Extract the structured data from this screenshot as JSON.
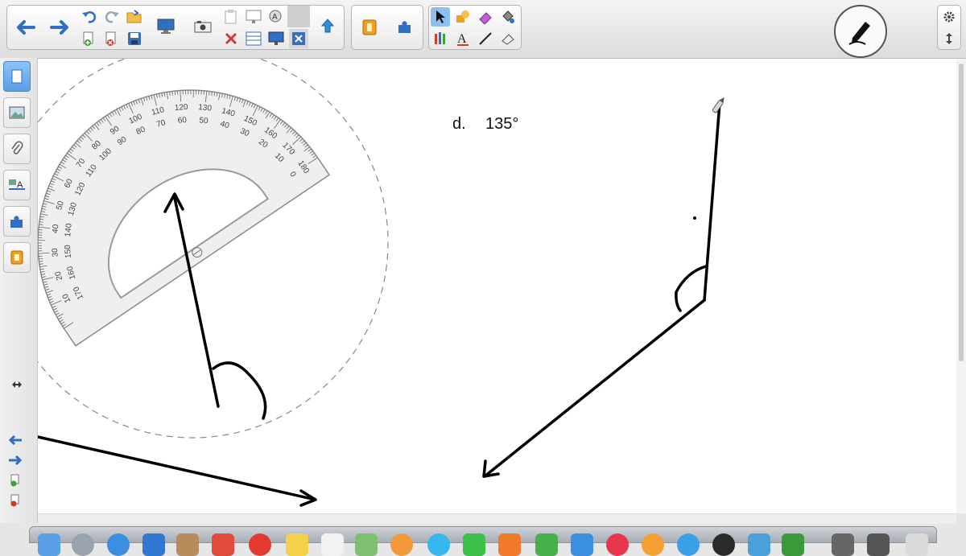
{
  "canvas": {
    "question_letter": "d.",
    "question_angle": "135°"
  },
  "protractor": {
    "outer_numbers": [
      "10",
      "20",
      "30",
      "40",
      "50",
      "60",
      "70",
      "80",
      "90",
      "100",
      "110",
      "120",
      "130",
      "140",
      "150",
      "160",
      "170",
      "180"
    ],
    "inner_numbers": [
      "170",
      "160",
      "150",
      "140",
      "130",
      "120",
      "110",
      "100",
      "90",
      "80",
      "70",
      "60",
      "50",
      "40",
      "30",
      "20",
      "10",
      "0"
    ]
  },
  "toolbar": {
    "icons": [
      "back-arrow",
      "forward-arrow",
      "undo",
      "redo",
      "open-file",
      "add-page",
      "delete-page",
      "save",
      "screen-display",
      "camera",
      "paste",
      "delete",
      "table",
      "screen-shade",
      "capture",
      "full-screen",
      "upload",
      "document-camera",
      "add-on",
      "select",
      "shapes",
      "eraser",
      "fill",
      "pens",
      "text",
      "line",
      "magic-eraser"
    ]
  },
  "colors": {
    "accent_blue": "#2f6fc4",
    "delete_red": "#d23b2b",
    "ink": "#111111",
    "orange": "#f0a020",
    "purple": "#c060d0"
  }
}
